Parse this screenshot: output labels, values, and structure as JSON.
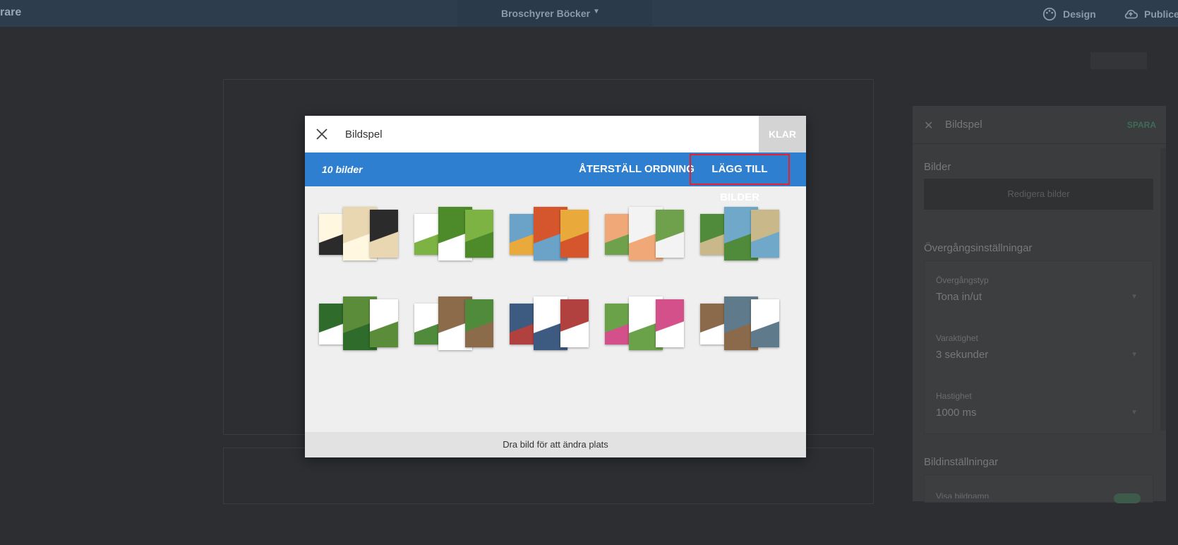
{
  "topbar": {
    "left_text": "rare",
    "project_title": "Broschyrer Böcker",
    "design_label": "Design",
    "publish_label": "Publice"
  },
  "side_panel": {
    "title": "Bildspel",
    "save_label": "SPARA",
    "images_heading": "Bilder",
    "edit_images_label": "Redigera bilder",
    "transition_heading": "Övergångsinställningar",
    "transition_type_label": "Övergångstyp",
    "transition_type_value": "Tona in/ut",
    "duration_label": "Varaktighet",
    "duration_value": "3 sekunder",
    "speed_label": "Hastighet",
    "speed_value": "1000 ms",
    "image_settings_heading": "Bildinställningar",
    "partial_label": "Visa bildnamn"
  },
  "modal": {
    "title": "Bildspel",
    "done_label": "KLAR",
    "image_count": "10 bilder",
    "reset_order_label": "ÅTERSTÄLL ORDNING",
    "add_images_label": "LÄGG TILL BILDER",
    "footer_hint": "Dra bild för att ändra plats"
  },
  "thumbnails": [
    {
      "name": "brochure-1",
      "colors": [
        "#e9d7b2",
        "#2b2b2b",
        "#fff7e0"
      ]
    },
    {
      "name": "brochure-2",
      "colors": [
        "#4d8b2a",
        "#7cb342",
        "#ffffff"
      ]
    },
    {
      "name": "brochure-3",
      "colors": [
        "#d5562d",
        "#e9a93b",
        "#6aa2c8"
      ]
    },
    {
      "name": "brochure-4",
      "colors": [
        "#f3f3f3",
        "#6fa14d",
        "#f0a878"
      ]
    },
    {
      "name": "brochure-5",
      "colors": [
        "#6fa8c9",
        "#c9b98a",
        "#4f8b3a"
      ]
    },
    {
      "name": "brochure-6",
      "colors": [
        "#5b8c3a",
        "#ffffff",
        "#2f6b2a"
      ]
    },
    {
      "name": "brochure-7",
      "colors": [
        "#8b6b4a",
        "#4f8b3a",
        "#ffffff"
      ]
    },
    {
      "name": "brochure-8",
      "colors": [
        "#ffffff",
        "#b0413e",
        "#3d5a80"
      ]
    },
    {
      "name": "brochure-9",
      "colors": [
        "#ffffff",
        "#d4508a",
        "#6aa24a"
      ]
    },
    {
      "name": "brochure-10",
      "colors": [
        "#5f7a8a",
        "#ffffff",
        "#8a6a4a"
      ]
    }
  ]
}
